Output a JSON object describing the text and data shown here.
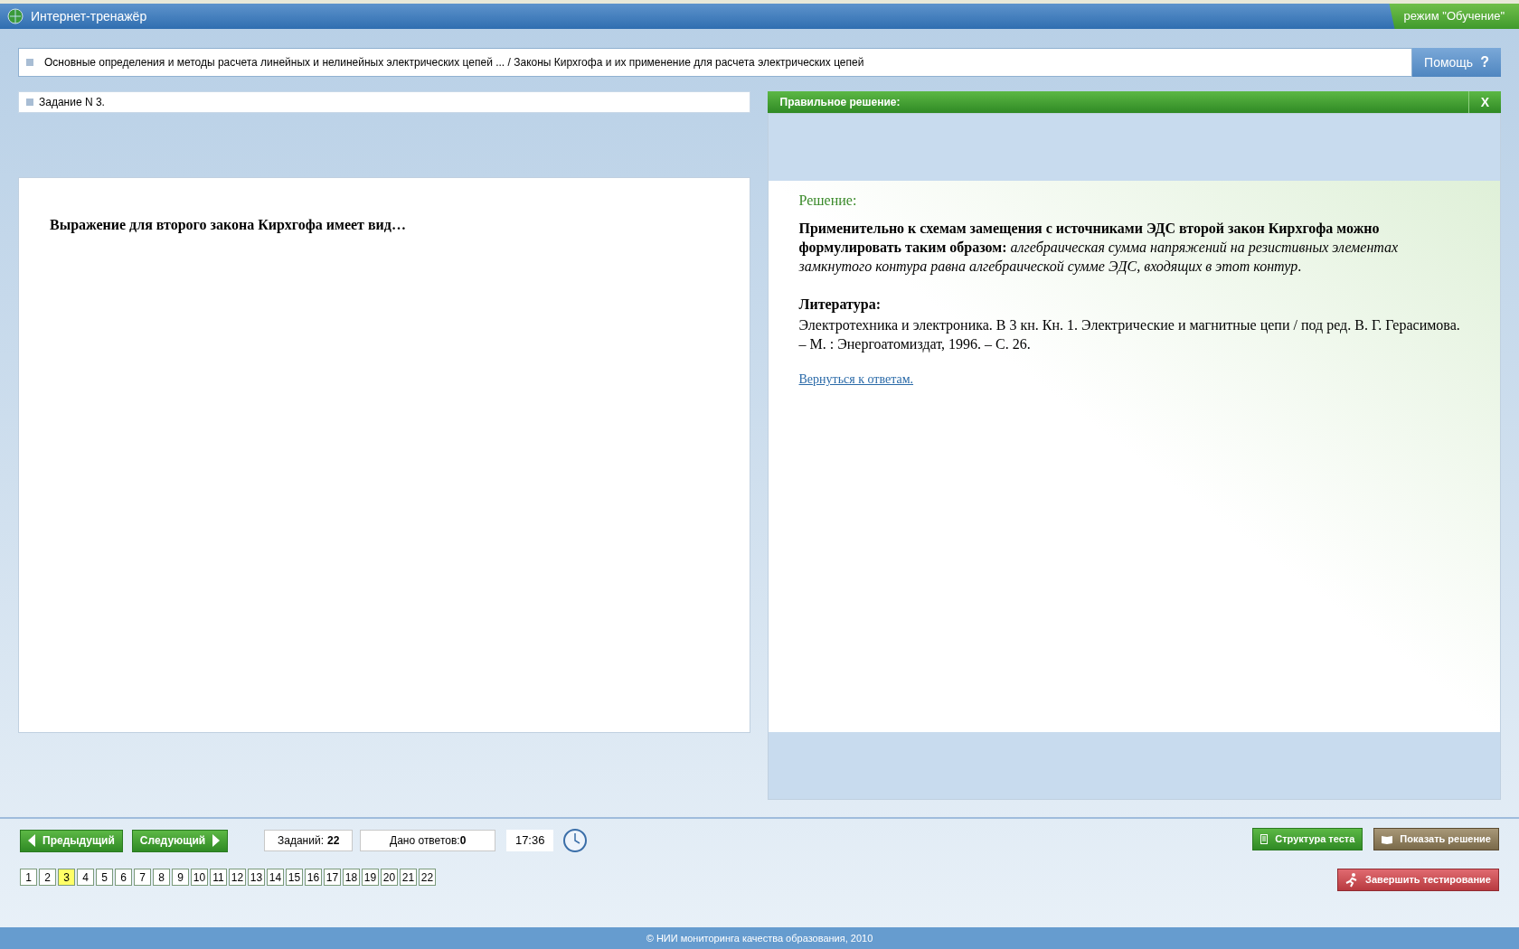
{
  "window": {
    "title": "Интернет-тренажёр",
    "mode": "режим \"Обучение\""
  },
  "breadcrumb": {
    "text": "Основные определения и методы расчета линейных и нелинейных электрических цепей ... / Законы Кирхгофа и их применение для расчета электрических цепей",
    "help": "Помощь",
    "help_icon": "?"
  },
  "task": {
    "title": "Задание N 3.",
    "question": "Выражение для второго закона Кирхгофа имеет вид…"
  },
  "solution_panel": {
    "title": "Правильное решение:",
    "close": "X",
    "heading": "Решение:",
    "text": "**Применительно к схемам замещения с источниками ЭДС второй закон Кирхгофа можно формулировать таким образом:** *алгебраическая сумма напряжений на резистивных элементах замкнутого контура равна алгебраической сумме ЭДС, входящих в этот контур*.",
    "literature_heading": "Литература:",
    "literature": "Электротехника и электроника. В 3 кн. Кн. 1. Электрические и магнитные цепи / под ред. В. Г. Герасимова. – М. : Энергоатомиздат, 1996. – С. 26.",
    "back_link": "Вернуться к ответам."
  },
  "navigation": {
    "previous": "Предыдущий",
    "next": "Следующий",
    "tasks_label": "Заданий:",
    "tasks_count": "22",
    "answers_label": "Дано ответов:",
    "answers_count": "0",
    "time": "17:36"
  },
  "pages": [
    {
      "label": "1",
      "selected": false
    },
    {
      "label": "2",
      "selected": false
    },
    {
      "label": "3",
      "selected": true
    },
    {
      "label": "4",
      "selected": false
    },
    {
      "label": "5",
      "selected": false
    },
    {
      "label": "6",
      "selected": false
    },
    {
      "label": "7",
      "selected": false
    },
    {
      "label": "8",
      "selected": false
    },
    {
      "label": "9",
      "selected": false
    },
    {
      "label": "10",
      "selected": false
    },
    {
      "label": "11",
      "selected": false
    },
    {
      "label": "12",
      "selected": false
    },
    {
      "label": "13",
      "selected": false
    },
    {
      "label": "14",
      "selected": false
    },
    {
      "label": "15",
      "selected": false
    },
    {
      "label": "16",
      "selected": false
    },
    {
      "label": "17",
      "selected": false
    },
    {
      "label": "18",
      "selected": false
    },
    {
      "label": "19",
      "selected": false
    },
    {
      "label": "20",
      "selected": false
    },
    {
      "label": "21",
      "selected": false
    },
    {
      "label": "22",
      "selected": false
    }
  ],
  "actions": {
    "structure": "Структура теста",
    "show_solution": "Показать решение",
    "finish": "Завершить тестирование"
  },
  "footer": "© НИИ мониторинга качества образования, 2010"
}
